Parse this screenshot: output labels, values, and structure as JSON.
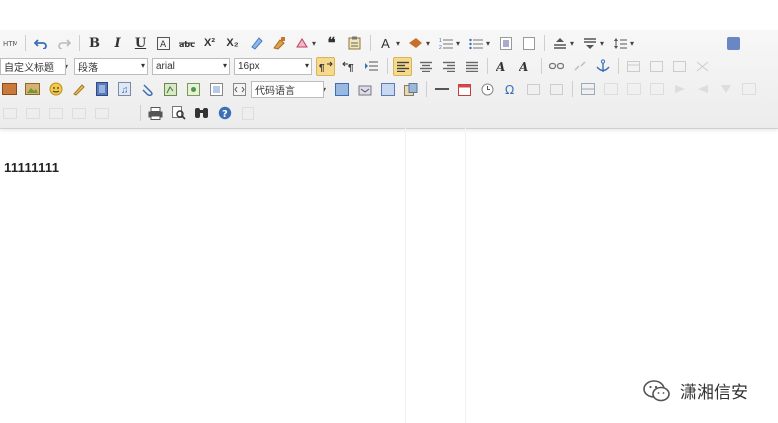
{
  "toolbar": {
    "row1": [
      "source-icon",
      "undo-icon",
      "redo-icon",
      "bold-icon",
      "italic-icon",
      "underline-icon",
      "font-border-icon",
      "strikethrough-icon",
      "superscript-icon",
      "subscript-icon",
      "remove-format-icon",
      "format-match-icon",
      "auto-typeset-icon",
      "blockquote-icon",
      "paste-plain-icon",
      "font-color-icon",
      "background-color-icon",
      "ordered-list-icon",
      "unordered-list-icon",
      "select-all-icon",
      "clear-doc-icon",
      "row-spacing-top-icon",
      "row-spacing-bottom-icon",
      "line-height-icon",
      "fullscreen-icon"
    ],
    "labels": {
      "bold": "B",
      "italic": "I",
      "underline": "U",
      "font_color": "A",
      "superscript": "X²",
      "subscript": "X₂",
      "quote": "❝"
    },
    "custom_style": "自定义标题",
    "paragraph": "段落",
    "font_family": "arial",
    "font_size": "16px",
    "code_language": "代码语言"
  },
  "content": {
    "text": "11111111"
  },
  "watermark": {
    "text": "潇湘信安"
  },
  "colors": {
    "toolbar_bg": "#efefef",
    "active_button": "#f6d98a",
    "icon_blue": "#3b6fb6"
  }
}
